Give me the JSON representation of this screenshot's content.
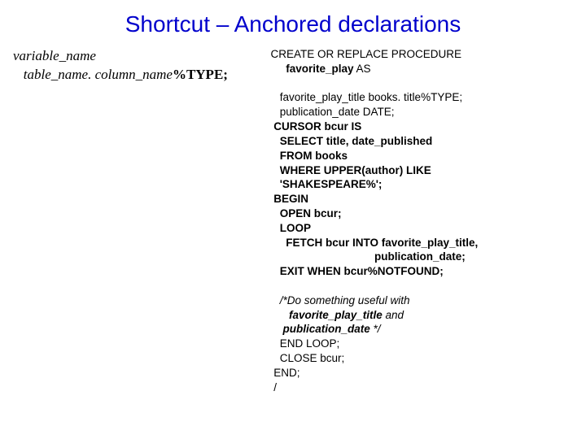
{
  "title": "Shortcut – Anchored declarations",
  "syntax": {
    "l1": "variable_name",
    "l2_a": "   table_name. column_name",
    "l2_b": "%TYPE;"
  },
  "code": {
    "l01a": "CREATE OR REPLACE PROCEDURE",
    "l01b": "     favorite_play",
    "l01c": " AS",
    "l02": "",
    "l03a": "   favorite_play_title books. title%TYPE;",
    "l04": "   publication_date DATE;",
    "l05": " CURSOR bcur IS",
    "l06": "   SELECT title, date_published",
    "l07": "   FROM books",
    "l08": "   WHERE UPPER(author) LIKE",
    "l09": "   'SHAKESPEARE%';",
    "l10": " BEGIN",
    "l11": "   OPEN bcur;",
    "l12": "   LOOP",
    "l13": "     FETCH bcur INTO favorite_play_title,",
    "l14": "                                  publication_date;",
    "l15": "   EXIT WHEN bcur%NOTFOUND;",
    "l16": "",
    "l17a": "   /*Do something useful with",
    "l17b": "      favorite_play_title",
    "l17c": " and",
    "l17d": "    publication_date",
    "l17e": " */",
    "l18": "   END LOOP;",
    "l19": "   CLOSE bcur;",
    "l20": " END;",
    "l21": " /"
  }
}
